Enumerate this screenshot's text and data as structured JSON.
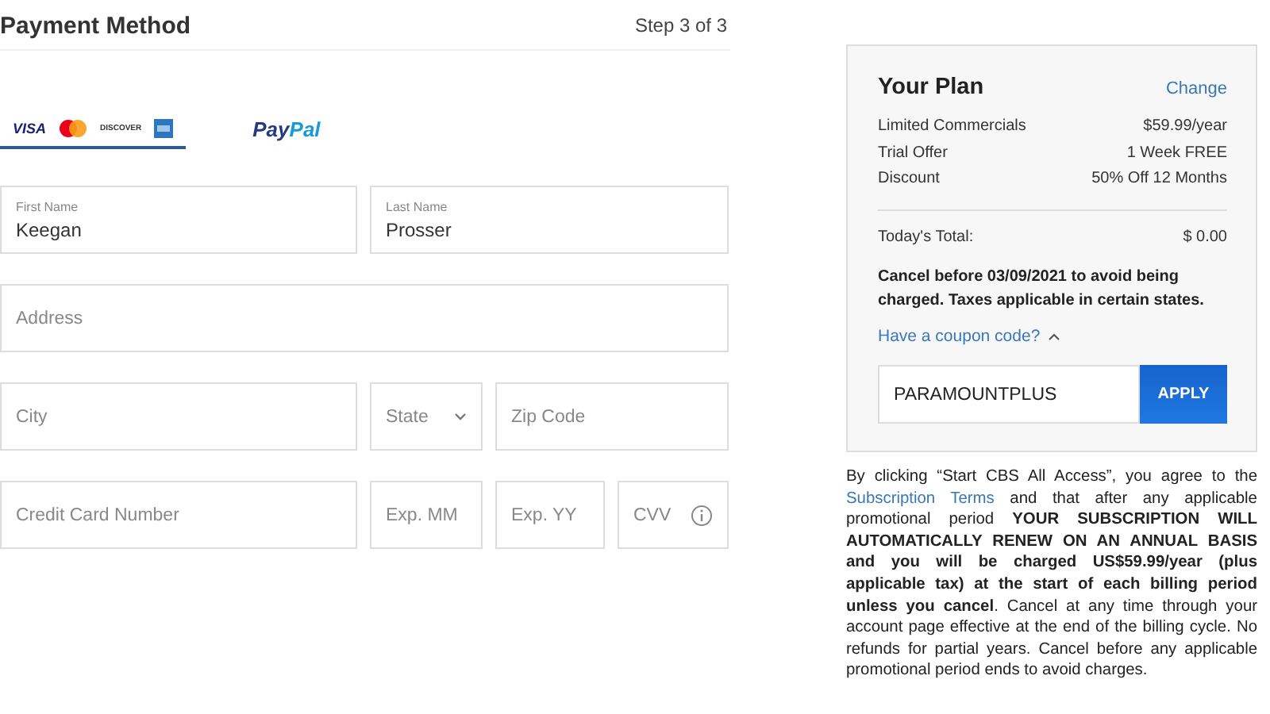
{
  "header": {
    "title": "Payment Method",
    "step": "Step 3 of 3"
  },
  "payment_tabs": [
    {
      "kind": "cards",
      "labels": [
        "VISA",
        "DISCOVER"
      ],
      "selected": true
    },
    {
      "kind": "paypal",
      "labels": [
        "Pay",
        "Pal"
      ],
      "selected": false
    }
  ],
  "form_rows": [
    [
      {
        "kind": "text",
        "label": "First Name",
        "value": "Keegan"
      },
      {
        "kind": "text",
        "label": "Last Name",
        "value": "Prosser"
      }
    ],
    [
      {
        "kind": "text",
        "placeholder": "Address"
      }
    ],
    [
      {
        "kind": "text",
        "placeholder": "City"
      },
      {
        "kind": "select",
        "placeholder": "State"
      },
      {
        "kind": "text",
        "placeholder": "Zip Code"
      }
    ],
    [
      {
        "kind": "text",
        "placeholder": "Credit Card Number"
      },
      {
        "kind": "text",
        "placeholder": "Exp. MM"
      },
      {
        "kind": "text",
        "placeholder": "Exp. YY"
      },
      {
        "kind": "info",
        "placeholder": "CVV"
      }
    ]
  ],
  "plan": {
    "title": "Your Plan",
    "change": "Change",
    "items": [
      {
        "label": "Limited Commercials",
        "value": "$59.99/year"
      },
      {
        "label": "Trial Offer",
        "value": "1 Week FREE"
      },
      {
        "label": "Discount",
        "value": "50% Off 12 Months"
      }
    ],
    "total": {
      "label": "Today's Total:",
      "value": "$ 0.00"
    },
    "notice": "Cancel before 03/09/2021 to avoid being charged. Taxes applicable in certain states.",
    "coupon": {
      "label": "Have a coupon code?",
      "expanded": true,
      "value": "PARAMOUNTPLUS",
      "button": "APPLY"
    }
  },
  "legal": {
    "before": "By clicking “Start CBS All Access”, you agree to the",
    "link": "Subscription Terms",
    "after": "and that after any applicable promotional period **YOUR SUBSCRIPTION WILL AUTOMATICALLY RENEW ON AN ANNUAL BASIS and you will be charged US$59.99/year (plus applicable tax) at the start of each billing period unless you cancel**. Cancel at any time through your account page effective at the end of the billing cycle. No refunds for partial years. Cancel before any applicable promotional period ends to avoid charges."
  }
}
